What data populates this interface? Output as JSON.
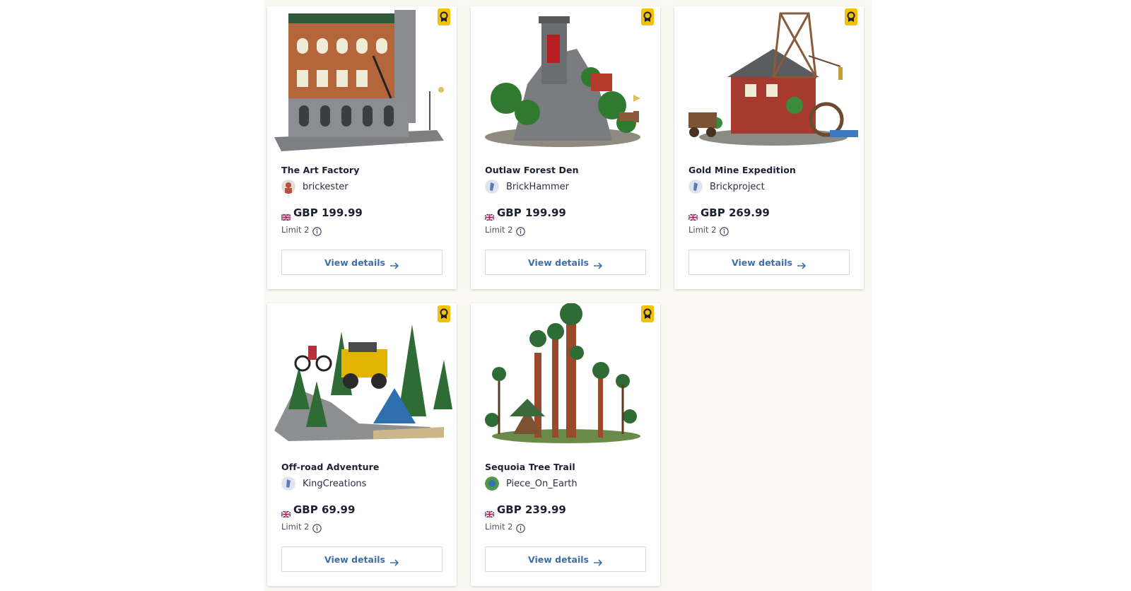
{
  "products": [
    {
      "title": "The Art Factory",
      "creator": "brickester",
      "avatar_color": "#b9503a",
      "currency": "GBP",
      "price": "GBP 199.99",
      "limit": "Limit 2",
      "cta": "View details"
    },
    {
      "title": "Outlaw Forest Den",
      "creator": "BrickHammer",
      "avatar_color": "#5a7ac0",
      "currency": "GBP",
      "price": "GBP 199.99",
      "limit": "Limit 2",
      "cta": "View details"
    },
    {
      "title": "Gold Mine Expedition",
      "creator": "Brickproject",
      "avatar_color": "#5a7ac0",
      "currency": "GBP",
      "price": "GBP 269.99",
      "limit": "Limit 2",
      "cta": "View details"
    },
    {
      "title": "Off-road Adventure",
      "creator": "KingCreations",
      "avatar_color": "#5a7ac0",
      "currency": "GBP",
      "price": "GBP 69.99",
      "limit": "Limit 2",
      "cta": "View details"
    },
    {
      "title": "Sequoia Tree Trail",
      "creator": "Piece_On_Earth",
      "avatar_color": "#4f9a4a",
      "currency": "GBP",
      "price": "GBP 239.99",
      "limit": "Limit 2",
      "cta": "View details"
    }
  ],
  "icons": {
    "badge": "award-icon",
    "flag": "uk-flag-icon",
    "info": "info-icon",
    "arrow": "arrow-right-icon"
  },
  "colors": {
    "badge": "#f2c200",
    "link": "#3d6ea8",
    "background": "#fbf9f3"
  }
}
